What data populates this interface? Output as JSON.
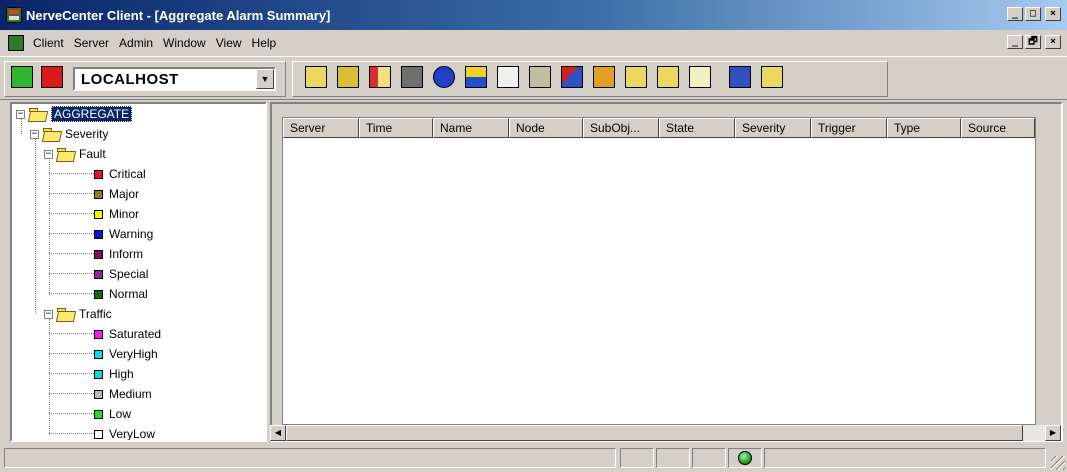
{
  "window": {
    "title": "NerveCenter Client - [Aggregate Alarm Summary]",
    "minimize": "_",
    "maximize": "□",
    "restore": "🗗",
    "close": "×"
  },
  "menu": [
    "Client",
    "Server",
    "Admin",
    "Window",
    "View",
    "Help"
  ],
  "toolbar": {
    "server_value": "LOCALHOST",
    "dropdown_arrow": "▼",
    "icons": [
      "connect-icon",
      "disconnect-icon",
      "mib-tool-icon",
      "computer-icon",
      "alarm-flag-icon",
      "wolf-icon",
      "molecule-icon",
      "tools-icon",
      "crit-min-inf-icon",
      "polygon-icon",
      "pencil-icon",
      "hierarchy-icon",
      "download-icon",
      "upload-icon",
      "list-icon",
      "question-doc-icon",
      "clipboard-icon"
    ]
  },
  "tree": {
    "root": "AGGREGATE",
    "severity": "Severity",
    "fault": "Fault",
    "fault_items": [
      {
        "label": "Critical",
        "color": "#e8141b"
      },
      {
        "label": "Major",
        "color": "#8a7d2c"
      },
      {
        "label": "Minor",
        "color": "#f5f500"
      },
      {
        "label": "Warning",
        "color": "#1010d8"
      },
      {
        "label": "Inform",
        "color": "#7d0f5d"
      },
      {
        "label": "Special",
        "color": "#8a2a8a"
      },
      {
        "label": "Normal",
        "color": "#136a15"
      }
    ],
    "traffic": "Traffic",
    "traffic_items": [
      {
        "label": "Saturated",
        "color": "#f020f0"
      },
      {
        "label": "VeryHigh",
        "color": "#10d8e0"
      },
      {
        "label": "High",
        "color": "#10d8e0"
      },
      {
        "label": "Medium",
        "color": "#b8b8b8"
      },
      {
        "label": "Low",
        "color": "#20e020"
      },
      {
        "label": "VeryLow",
        "color": "#ffffff"
      }
    ]
  },
  "columns": [
    "Server",
    "Time",
    "Name",
    "Node",
    "SubObj...",
    "State",
    "Severity",
    "Trigger",
    "Type",
    "Source"
  ],
  "scroll": {
    "left": "◀",
    "right": "▶"
  }
}
